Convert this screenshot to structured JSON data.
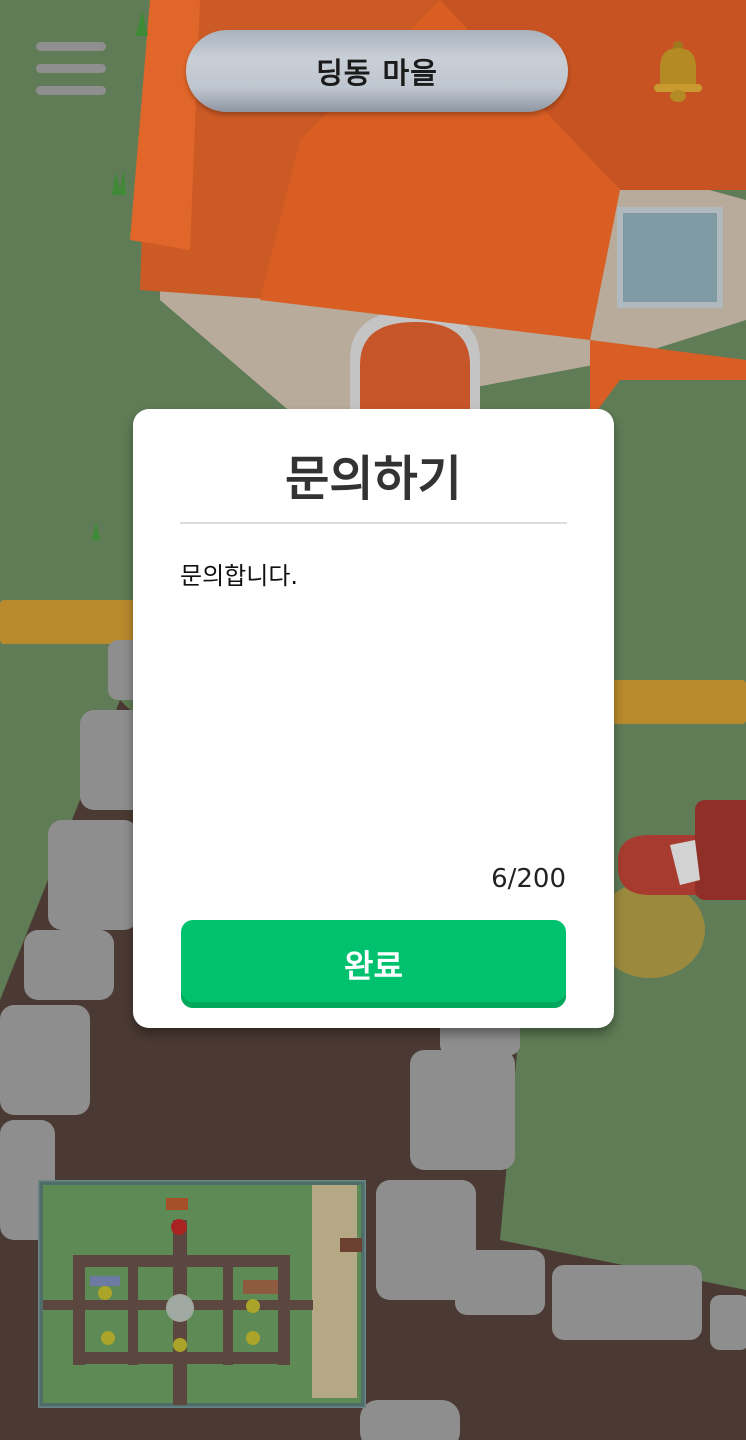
{
  "header": {
    "village_name": "딩동 마을"
  },
  "modal": {
    "title": "문의하기",
    "message": "문의합니다.",
    "char_count": "6/200",
    "submit_label": "완료"
  },
  "colors": {
    "accent_green": "#00c26e",
    "roof_orange": "#d8581c",
    "grass": "#5e7b55",
    "dirt": "#4a3a33"
  },
  "icons": {
    "menu": "hamburger-menu-icon",
    "notification": "bell-icon"
  }
}
